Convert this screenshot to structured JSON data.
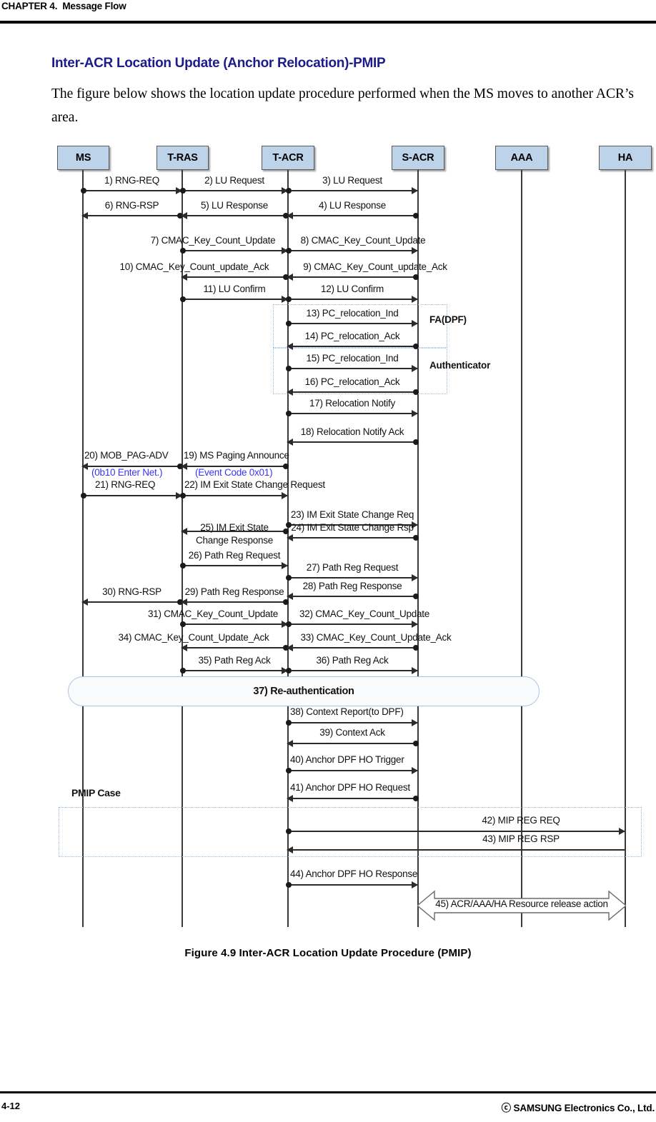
{
  "page": {
    "running_header": "CHAPTER 4.  Message Flow",
    "footer_page_number": "4-12",
    "footer_copyright": "ⓒ SAMSUNG Electronics Co., Ltd.",
    "heading": "Inter-ACR Location Update (Anchor Relocation)-PMIP",
    "paragraph": "The figure below shows the location update procedure performed when the MS moves to another ACR’s area.",
    "figure_caption": "Figure 4.9 Inter-ACR Location Update Procedure (PMIP)"
  },
  "colors": {
    "heading_blue": "#1c1c8c",
    "annotation_blue": "#3a36f0",
    "lane_fill": "#bdd3ea",
    "lane_border": "#5a5a5a",
    "dash_border": "#9bbde0",
    "capsule_border": "#a9c6e4",
    "line": "#2b2b2b"
  },
  "diagram": {
    "lanes": [
      {
        "id": "ms",
        "label": "MS"
      },
      {
        "id": "tras",
        "label": "T-RAS"
      },
      {
        "id": "tacr",
        "label": "T-ACR"
      },
      {
        "id": "sacr",
        "label": "S-ACR"
      },
      {
        "id": "aaa",
        "label": "AAA"
      },
      {
        "id": "ha",
        "label": "HA"
      }
    ],
    "group_labels": [
      {
        "id": "fa-dpf",
        "text": "FA(DPF)"
      },
      {
        "id": "authenticator",
        "text": "Authenticator"
      },
      {
        "id": "pmip-case",
        "text": "PMIP Case"
      }
    ],
    "capsule": {
      "label": "37) Re-authentication"
    },
    "resource_release": {
      "label": "45) ACR/AAA/HA Resource release action"
    },
    "messages": [
      {
        "n": "1",
        "label": "1) RNG-REQ"
      },
      {
        "n": "2",
        "label": "2) LU Request"
      },
      {
        "n": "3",
        "label": "3) LU Request"
      },
      {
        "n": "4",
        "label": "4) LU Response"
      },
      {
        "n": "5",
        "label": "5) LU Response"
      },
      {
        "n": "6",
        "label": "6) RNG-RSP"
      },
      {
        "n": "7",
        "label": "7) CMAC_Key_Count_Update"
      },
      {
        "n": "8",
        "label": "8) CMAC_Key_Count_Update"
      },
      {
        "n": "9",
        "label": "9) CMAC_Key_Count_update_Ack"
      },
      {
        "n": "10",
        "label": "10) CMAC_Key_Count_update_Ack"
      },
      {
        "n": "11",
        "label": "11) LU Confirm"
      },
      {
        "n": "12",
        "label": "12) LU Confirm"
      },
      {
        "n": "13",
        "label": "13) PC_relocation_Ind"
      },
      {
        "n": "14",
        "label": "14) PC_relocation_Ack"
      },
      {
        "n": "15",
        "label": "15) PC_relocation_Ind"
      },
      {
        "n": "16",
        "label": "16) PC_relocation_Ack"
      },
      {
        "n": "17",
        "label": "17) Relocation Notify"
      },
      {
        "n": "18",
        "label": "18) Relocation Notify Ack"
      },
      {
        "n": "19",
        "label": "19) MS Paging Announce"
      },
      {
        "n": "19b",
        "label": "(Event Code 0x01)"
      },
      {
        "n": "20",
        "label": "20) MOB_PAG-ADV"
      },
      {
        "n": "20b",
        "label": "(0b10 Enter Net.)"
      },
      {
        "n": "21",
        "label": "21) RNG-REQ"
      },
      {
        "n": "22",
        "label": "22) IM Exit State Change Request"
      },
      {
        "n": "23",
        "label": "23) IM Exit State Change Req"
      },
      {
        "n": "24",
        "label": "24) IM Exit State Change Rsp"
      },
      {
        "n": "25",
        "label": "25) IM Exit State"
      },
      {
        "n": "25b",
        "label": "Change Response"
      },
      {
        "n": "26",
        "label": "26) Path Reg Request"
      },
      {
        "n": "27",
        "label": "27) Path Reg Request"
      },
      {
        "n": "28",
        "label": "28) Path Reg Response"
      },
      {
        "n": "29",
        "label": "29) Path Reg Response"
      },
      {
        "n": "30",
        "label": "30) RNG-RSP"
      },
      {
        "n": "31",
        "label": "31) CMAC_Key_Count_Update"
      },
      {
        "n": "32",
        "label": "32) CMAC_Key_Count_Update"
      },
      {
        "n": "33",
        "label": "33) CMAC_Key_Count_Update_Ack"
      },
      {
        "n": "34",
        "label": "34) CMAC_Key_Count_Update_Ack"
      },
      {
        "n": "35",
        "label": "35) Path Reg Ack"
      },
      {
        "n": "36",
        "label": "36) Path Reg Ack"
      },
      {
        "n": "38",
        "label": "38) Context Report(to DPF)"
      },
      {
        "n": "39",
        "label": "39) Context Ack"
      },
      {
        "n": "40",
        "label": "40) Anchor DPF HO Trigger"
      },
      {
        "n": "41",
        "label": "41) Anchor DPF HO Request"
      },
      {
        "n": "42",
        "label": "42) MIP REG REQ"
      },
      {
        "n": "43",
        "label": "43) MIP REG RSP"
      },
      {
        "n": "44",
        "label": "44) Anchor DPF HO Response"
      }
    ]
  }
}
